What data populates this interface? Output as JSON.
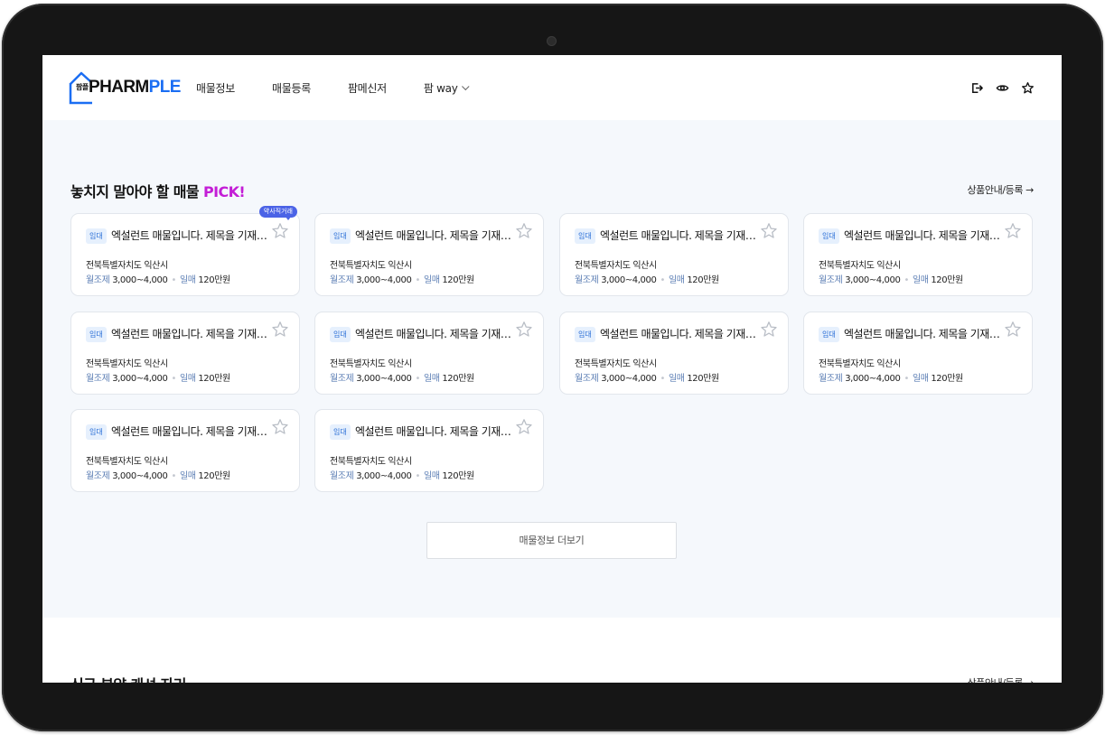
{
  "header": {
    "logo_ko": "팜플",
    "logo_main": "PHARM",
    "logo_accent": "PLE",
    "nav": [
      {
        "label": "매물정보"
      },
      {
        "label": "매물등록"
      },
      {
        "label": "팜메신저"
      },
      {
        "label": "팜 way"
      }
    ],
    "icons": [
      "logout-icon",
      "eye-icon",
      "star-icon"
    ]
  },
  "pick_section": {
    "title": "놓치지 말아야 할 매물",
    "title_accent": "PICK!",
    "link_label": "상품안내/등록 →",
    "accent_color": "#c31dd6",
    "cards": [
      {
        "tag": "임대",
        "title": "엑설런트 매물입니다. 제목을 기재해주세요",
        "location": "전북특별자치도 익산시",
        "rent_label": "월조제",
        "rent_value": "3,000~4,000",
        "sale_label": "일매",
        "sale_value": "120만원",
        "badge": "약사직거래",
        "favorite": false
      },
      {
        "tag": "임대",
        "title": "엑설런트 매물입니다. 제목을 기재해주세요",
        "location": "전북특별자치도 익산시",
        "rent_label": "월조제",
        "rent_value": "3,000~4,000",
        "sale_label": "일매",
        "sale_value": "120만원",
        "favorite": false
      },
      {
        "tag": "임대",
        "title": "엑설런트 매물입니다. 제목을 기재해주세요",
        "location": "전북특별자치도 익산시",
        "rent_label": "월조제",
        "rent_value": "3,000~4,000",
        "sale_label": "일매",
        "sale_value": "120만원",
        "favorite": false
      },
      {
        "tag": "임대",
        "title": "엑설런트 매물입니다. 제목을 기재해주세요",
        "location": "전북특별자치도 익산시",
        "rent_label": "월조제",
        "rent_value": "3,000~4,000",
        "sale_label": "일매",
        "sale_value": "120만원",
        "favorite": false
      },
      {
        "tag": "임대",
        "title": "엑설런트 매물입니다. 제목을 기재해주세요",
        "location": "전북특별자치도 익산시",
        "rent_label": "월조제",
        "rent_value": "3,000~4,000",
        "sale_label": "일매",
        "sale_value": "120만원",
        "favorite": false
      },
      {
        "tag": "임대",
        "title": "엑설런트 매물입니다. 제목을 기재해주세요",
        "location": "전북특별자치도 익산시",
        "rent_label": "월조제",
        "rent_value": "3,000~4,000",
        "sale_label": "일매",
        "sale_value": "120만원",
        "favorite": false
      },
      {
        "tag": "임대",
        "title": "엑설런트 매물입니다. 제목을 기재해주세요",
        "location": "전북특별자치도 익산시",
        "rent_label": "월조제",
        "rent_value": "3,000~4,000",
        "sale_label": "일매",
        "sale_value": "120만원",
        "favorite": false
      },
      {
        "tag": "임대",
        "title": "엑설런트 매물입니다. 제목을 기재해주세요",
        "location": "전북특별자치도 익산시",
        "rent_label": "월조제",
        "rent_value": "3,000~4,000",
        "sale_label": "일매",
        "sale_value": "120만원",
        "favorite": false
      },
      {
        "tag": "임대",
        "title": "엑설런트 매물입니다. 제목을 기재해주세요",
        "location": "전북특별자치도 익산시",
        "rent_label": "월조제",
        "rent_value": "3,000~4,000",
        "sale_label": "일매",
        "sale_value": "120만원",
        "favorite": false
      },
      {
        "tag": "임대",
        "title": "엑설런트 매물입니다. 제목을 기재해주세요",
        "location": "전북특별자치도 익산시",
        "rent_label": "월조제",
        "rent_value": "3,000~4,000",
        "sale_label": "일매",
        "sale_value": "120만원",
        "favorite": false
      }
    ],
    "more_button": "매물정보 더보기"
  },
  "next_section": {
    "title": "신규 분양 캐셔 자리",
    "link_label": "상품안내/등록 →"
  },
  "colors": {
    "brand_blue": "#1b6ef3",
    "tag_bg": "#e6f0fd",
    "tag_text": "#2a6ed6",
    "badge_bg": "#4b63e6",
    "section_bg": "#f5f8fc"
  }
}
